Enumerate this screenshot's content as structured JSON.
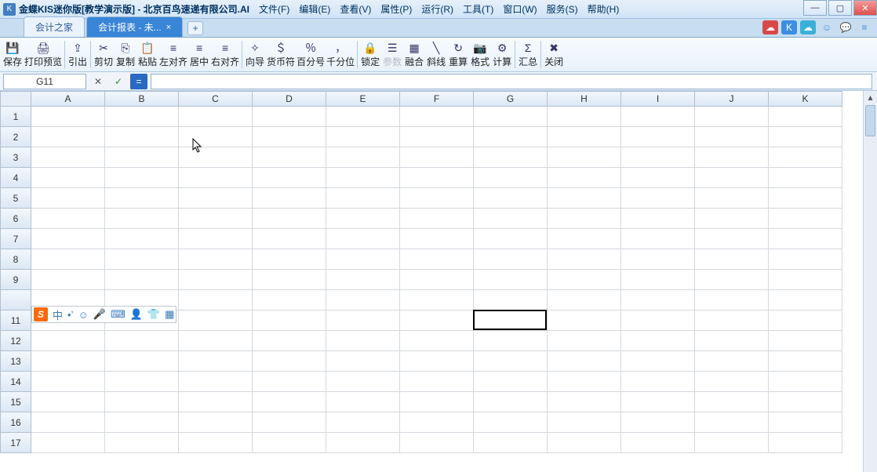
{
  "title": {
    "app": "金蝶KIS迷你版[教学演示版]",
    "dash": " - ",
    "doc": "北京百鸟速递有限公司.AI"
  },
  "menus": [
    "文件(F)",
    "编辑(E)",
    "查看(V)",
    "属性(P)",
    "运行(R)",
    "工具(T)",
    "窗口(W)",
    "服务(S)",
    "帮助(H)"
  ],
  "tabs": {
    "home": "会计之家",
    "active": "会计报表 - 未..."
  },
  "toolbar": [
    {
      "id": "save",
      "label": "保存",
      "icon": "💾"
    },
    {
      "id": "preview",
      "label": "打印预览",
      "icon": "🖨"
    },
    {
      "sep": true
    },
    {
      "id": "export",
      "label": "引出",
      "icon": "⇪"
    },
    {
      "sep": true
    },
    {
      "id": "cut",
      "label": "剪切",
      "icon": "✂"
    },
    {
      "id": "copy",
      "label": "复制",
      "icon": "⎘"
    },
    {
      "id": "paste",
      "label": "粘贴",
      "icon": "📋"
    },
    {
      "id": "alignl",
      "label": "左对齐",
      "icon": "≡"
    },
    {
      "id": "alignc",
      "label": "居中",
      "icon": "≡"
    },
    {
      "id": "alignr",
      "label": "右对齐",
      "icon": "≡"
    },
    {
      "sep": true
    },
    {
      "id": "wizard",
      "label": "向导",
      "icon": "✧"
    },
    {
      "id": "currency",
      "label": "货币符",
      "icon": "＄"
    },
    {
      "id": "percent",
      "label": "百分号",
      "icon": "％"
    },
    {
      "id": "thousand",
      "label": "千分位",
      "icon": "，"
    },
    {
      "sep": true
    },
    {
      "id": "lock",
      "label": "锁定",
      "icon": "🔒"
    },
    {
      "id": "param",
      "label": "参数",
      "icon": "☰",
      "disabled": true
    },
    {
      "id": "merge",
      "label": "融合",
      "icon": "▦"
    },
    {
      "id": "diag",
      "label": "斜线",
      "icon": "╲"
    },
    {
      "id": "recalc",
      "label": "重算",
      "icon": "↻"
    },
    {
      "id": "format",
      "label": "格式",
      "icon": "📷"
    },
    {
      "id": "calc",
      "label": "计算",
      "icon": "⚙"
    },
    {
      "sep": true
    },
    {
      "id": "summary",
      "label": "汇总",
      "icon": "Σ"
    },
    {
      "sep": true
    },
    {
      "id": "close",
      "label": "关闭",
      "icon": "✖"
    }
  ],
  "formulabar": {
    "namebox": "G11",
    "cancel": "✕",
    "confirm": "✓",
    "fx": "="
  },
  "columns": [
    "A",
    "B",
    "C",
    "D",
    "E",
    "F",
    "G",
    "H",
    "I",
    "J",
    "K"
  ],
  "rows": [
    "1",
    "2",
    "3",
    "4",
    "5",
    "6",
    "7",
    "8",
    "9",
    "",
    "11",
    "12",
    "13",
    "14",
    "15",
    "16",
    "17"
  ],
  "ime": {
    "logo": "S",
    "items": [
      "中",
      "•ʼ",
      "☺",
      "🎤",
      "⌨",
      "👤",
      "👕",
      "▦"
    ]
  },
  "active_cell": {
    "col": 6,
    "row": 10
  },
  "win": {
    "min": "—",
    "max": "▢",
    "close": "✕"
  },
  "right_icons": [
    "☁",
    "K",
    "☁",
    "☺",
    "💬",
    "≡"
  ]
}
